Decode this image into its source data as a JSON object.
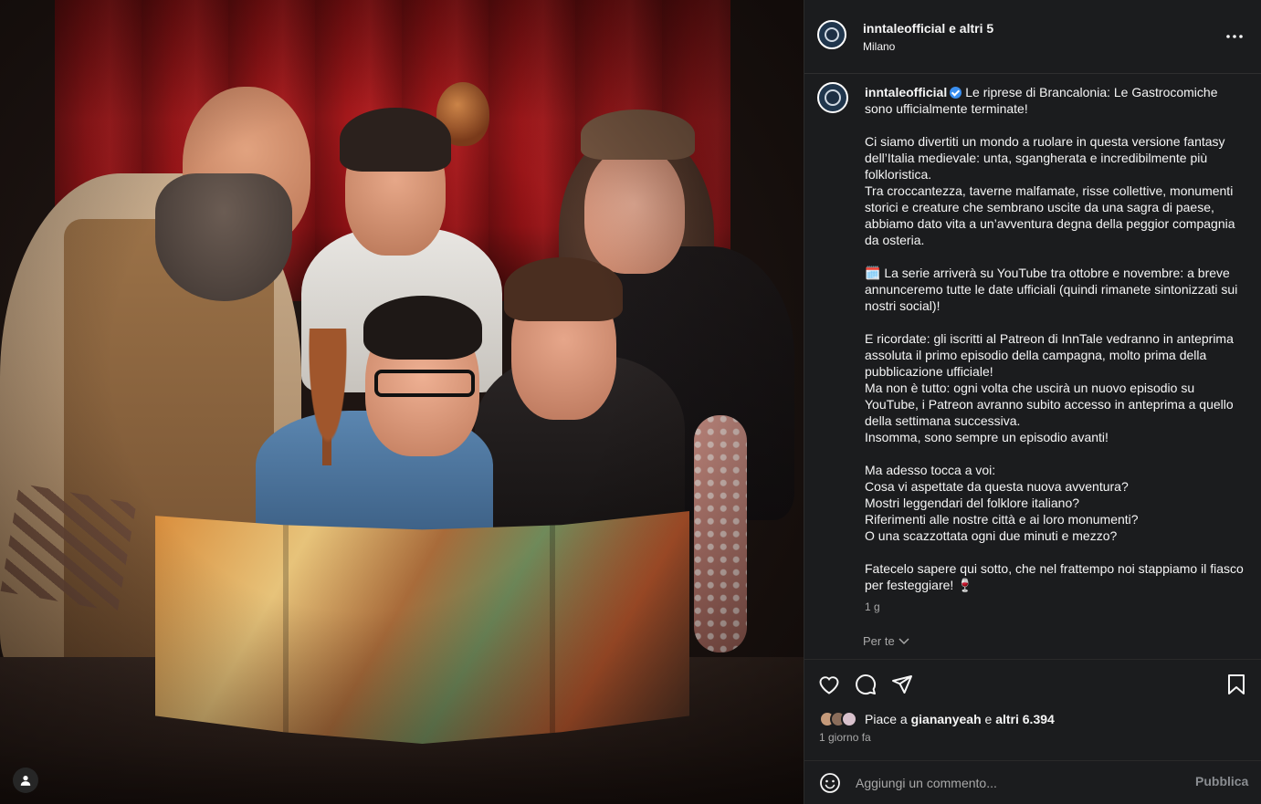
{
  "post": {
    "image_alt": "",
    "header": {
      "username": "inntaleofficial",
      "coauthors": "e altri 5",
      "location": "Milano"
    },
    "caption": {
      "username": "inntaleofficial",
      "text": "Le riprese di Brancalonia: Le Gastrocomiche sono ufficialmente terminate!\n\nCi siamo divertiti un mondo a ruolare in questa versione fantasy dell’Italia medievale: unta, sgangherata e incredibilmente più folkloristica.\nTra croccantezza, taverne malfamate, risse collettive, monumenti storici e creature che sembrano uscite da una sagra di paese, abbiamo dato vita a un’avventura degna della peggior compagnia da osteria.\n\n🗓️ La serie arriverà su YouTube tra ottobre e novembre: a breve annunceremo tutte le date ufficiali (quindi rimanete sintonizzati sui nostri social)!\n\nE ricordate: gli iscritti al Patreon di InnTale vedranno in anteprima assoluta il primo episodio della campagna, molto prima della pubblicazione ufficiale!\nMa non è tutto: ogni volta che uscirà un nuovo episodio su YouTube, i Patreon avranno subito accesso in anteprima a quello della settimana successiva.\nInsomma, sono sempre un episodio avanti!\n\nMa adesso tocca a voi:\nCosa vi aspettate da questa nuova avventura?\nMostri leggendari del folklore italiano?\nRiferimenti alle nostre città e ai loro monumenti?\nO una scazzottata ogni due minuti e mezzo?\n\nFatecelo sapere qui sotto, che nel frattempo noi stappiamo il fiasco per festeggiare! 🍷",
      "time": "1 g",
      "for_you": "Per te"
    },
    "likes": {
      "prefix": "Piace a ",
      "user": "giananyeah",
      "middle": " e ",
      "others": "altri 6.394"
    },
    "date": "1 giorno fa",
    "comment": {
      "placeholder": "Aggiungi un commento...",
      "publish": "Pubblica"
    },
    "icons": {
      "like": "heart-icon",
      "comment": "comment-icon",
      "share": "share-icon",
      "save": "bookmark-icon",
      "more": "more-icon",
      "emoji": "emoji-icon",
      "user_tag": "user-tag-icon"
    },
    "colors": {
      "panel_bg": "#1b1c1e",
      "verified": "#3a8ff0",
      "muted": "#a8a8a8"
    }
  }
}
